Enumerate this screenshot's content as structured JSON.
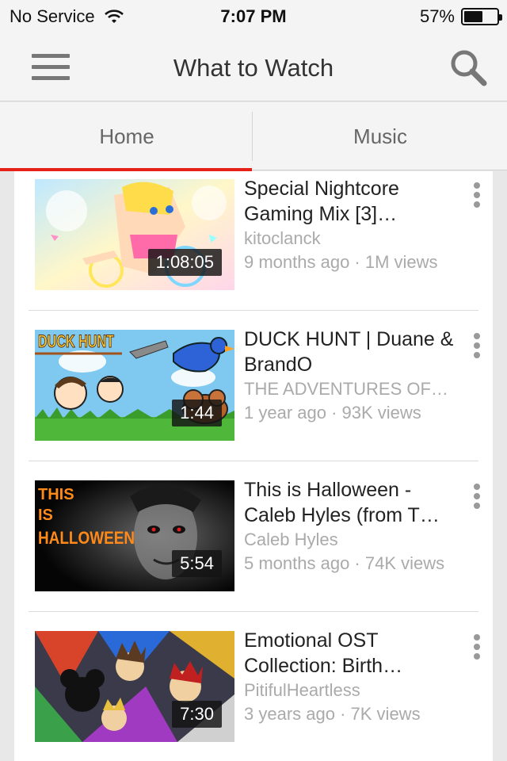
{
  "status_bar": {
    "carrier": "No Service",
    "time": "7:07 PM",
    "battery_percent": "57%",
    "battery_level": 0.57
  },
  "app_bar": {
    "title": "What to Watch",
    "menu_icon": "hamburger-menu-icon",
    "search_icon": "search-icon"
  },
  "tabs": [
    {
      "label": "Home",
      "active": true
    },
    {
      "label": "Music",
      "active": false
    }
  ],
  "accent_color": "#e62117",
  "videos": [
    {
      "title": "Special Nightcore Gaming Mix [3]…",
      "channel": "kitoclanck",
      "age": "9 months ago",
      "views": "1M views",
      "duration": "1:08:05",
      "thumb_text": ""
    },
    {
      "title": "DUCK HUNT | Duane & BrandO",
      "channel": "THE ADVENTURES OF…",
      "age": "1 year ago",
      "views": "93K views",
      "duration": "1:44",
      "thumb_text": "DUCK HUNT"
    },
    {
      "title": "This is Halloween - Caleb Hyles (from T…",
      "channel": "Caleb Hyles",
      "age": "5 months ago",
      "views": "74K views",
      "duration": "5:54",
      "thumb_text": "THIS IS HALLOWEEN"
    },
    {
      "title": "Emotional OST Collection: Birth…",
      "channel": "PitifulHeartless",
      "age": "3 years ago",
      "views": "7K views",
      "duration": "7:30",
      "thumb_text": ""
    }
  ],
  "stats_separator": " · "
}
